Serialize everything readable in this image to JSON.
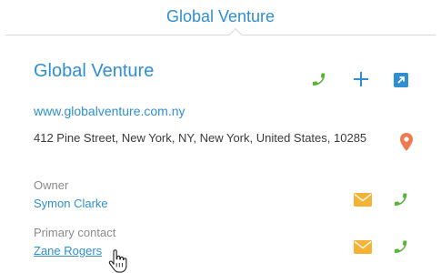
{
  "header": {
    "title": "Global Venture"
  },
  "card": {
    "title": "Global Venture",
    "website": "www.globalventure.com.ny",
    "address": "412 Pine Street, New York, NY, New York, United States, 10285"
  },
  "owner": {
    "label": "Owner",
    "name": "Symon Clarke"
  },
  "primary_contact": {
    "label": "Primary contact",
    "name": "Zane Rogers"
  },
  "icons": {
    "phone": "phone-icon",
    "add": "plus-icon",
    "open": "open-link-icon",
    "map": "map-pin-icon",
    "email": "envelope-icon",
    "cursor": "hand-cursor-icon"
  },
  "colors": {
    "accent": "#2f8fd0",
    "phone": "#5bb33a",
    "email": "#f5b335",
    "pin": "#f07a4f"
  }
}
